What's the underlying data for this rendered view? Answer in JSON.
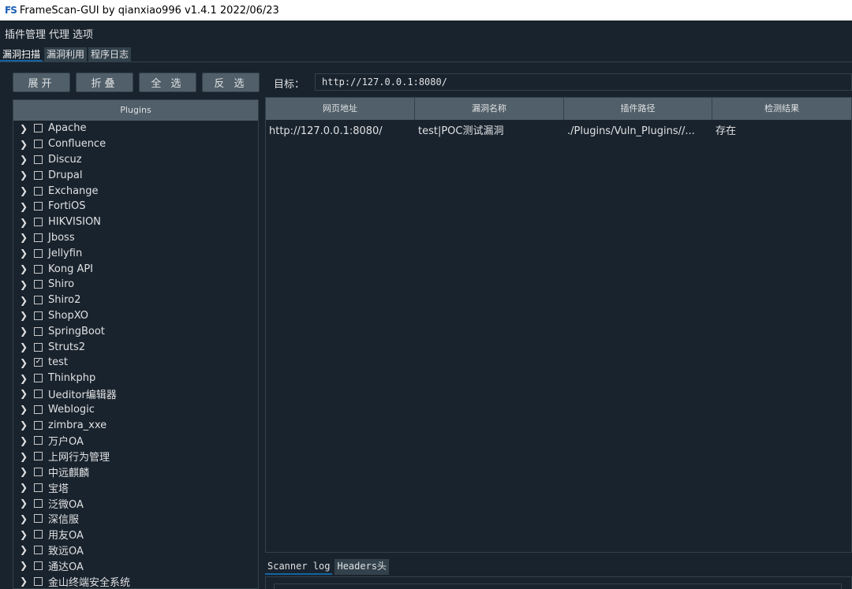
{
  "window": {
    "logo": "FS",
    "title": "FrameScan-GUI  by qianxiao996 v1.4.1 2022/06/23"
  },
  "menu": [
    "插件管理",
    "代理",
    "选项"
  ],
  "tabs": [
    "漏洞扫描",
    "漏洞利用",
    "程序日志"
  ],
  "buttons": {
    "expand": "展开",
    "collapse": "折叠",
    "select_all": "全 选",
    "invert": "反 选"
  },
  "target": {
    "label": "目标：",
    "value": "http://127.0.0.1:8080/"
  },
  "plugins": {
    "header": "Plugins",
    "items": [
      {
        "label": "Apache",
        "checked": false
      },
      {
        "label": "Confluence",
        "checked": false
      },
      {
        "label": "Discuz",
        "checked": false
      },
      {
        "label": "Drupal",
        "checked": false
      },
      {
        "label": "Exchange",
        "checked": false
      },
      {
        "label": "FortiOS",
        "checked": false
      },
      {
        "label": "HIKVISION",
        "checked": false
      },
      {
        "label": "Jboss",
        "checked": false
      },
      {
        "label": "Jellyfin",
        "checked": false
      },
      {
        "label": "Kong API",
        "checked": false
      },
      {
        "label": "Shiro",
        "checked": false
      },
      {
        "label": "Shiro2",
        "checked": false
      },
      {
        "label": "ShopXO",
        "checked": false
      },
      {
        "label": "SpringBoot",
        "checked": false
      },
      {
        "label": "Struts2",
        "checked": false
      },
      {
        "label": "test",
        "checked": true
      },
      {
        "label": "Thinkphp",
        "checked": false
      },
      {
        "label": "Ueditor编辑器",
        "checked": false
      },
      {
        "label": "Weblogic",
        "checked": false
      },
      {
        "label": "zimbra_xxe",
        "checked": false
      },
      {
        "label": "万户OA",
        "checked": false
      },
      {
        "label": "上网行为管理",
        "checked": false
      },
      {
        "label": "中远麒麟",
        "checked": false
      },
      {
        "label": "宝塔",
        "checked": false
      },
      {
        "label": "泛微OA",
        "checked": false
      },
      {
        "label": "深信服",
        "checked": false
      },
      {
        "label": "用友OA",
        "checked": false
      },
      {
        "label": "致远OA",
        "checked": false
      },
      {
        "label": "通达OA",
        "checked": false
      },
      {
        "label": "金山终端安全系统",
        "checked": false
      }
    ]
  },
  "results": {
    "columns": [
      "网页地址",
      "漏洞名称",
      "插件路径",
      "检测结果"
    ],
    "rows": [
      [
        "http://127.0.0.1:8080/",
        "test|POC测试漏洞",
        "./Plugins/Vuln_Plugins//...",
        "存在"
      ]
    ]
  },
  "bottom_tabs": [
    "Scanner log",
    "Headers头"
  ],
  "colors": {
    "background": "#19232d",
    "button": "#505f69",
    "border": "#32414b",
    "accent": "#1464a0"
  }
}
